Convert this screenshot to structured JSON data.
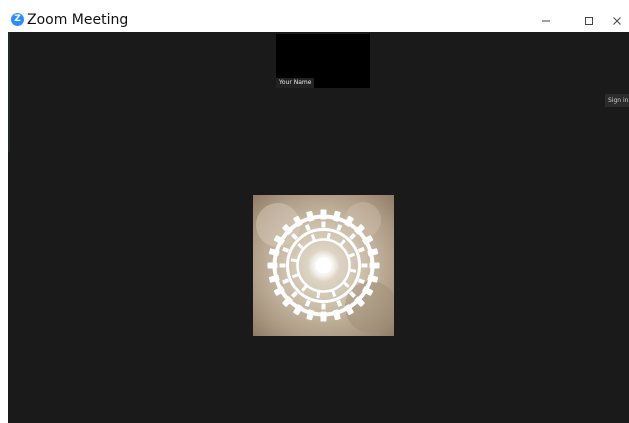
{
  "window": {
    "title": "Zoom Meeting",
    "app_icon_glyph": "Z",
    "controls": {
      "minimize_icon": "minimize-icon",
      "maximize_icon": "maximize-icon",
      "close_icon": "close-icon"
    }
  },
  "meeting": {
    "self_view": {
      "name": "Your Name"
    },
    "sign_in_label": "Sign in",
    "participant_avatar_icon": "avatar"
  },
  "colors": {
    "stage_background": "#1a1a1a",
    "brand_blue": "#2D8CFF",
    "titlebar": "#ffffff"
  }
}
